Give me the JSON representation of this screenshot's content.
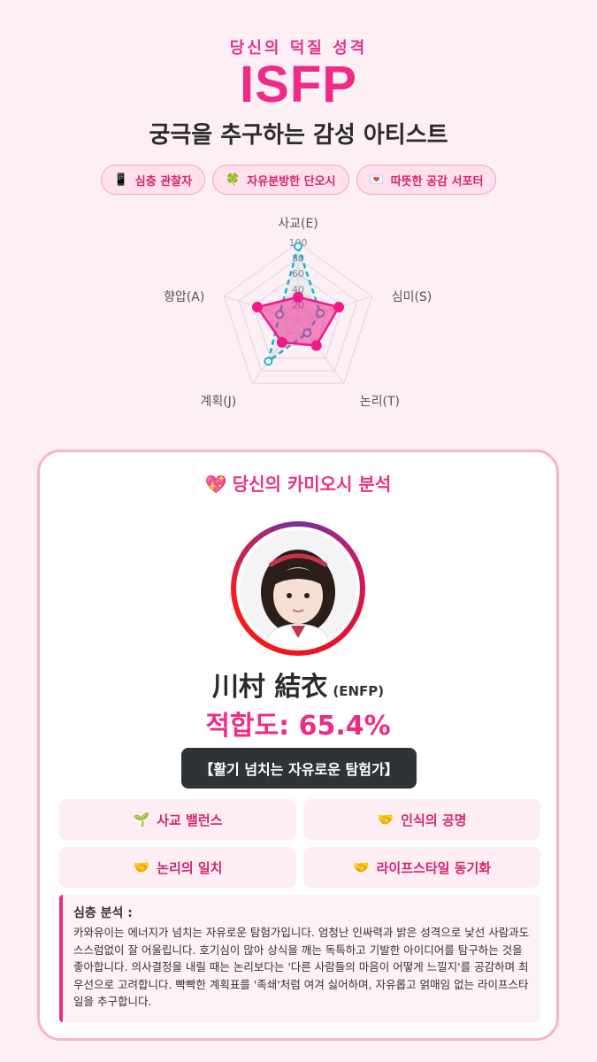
{
  "header": {
    "subtitle": "당신의 덕질 성격",
    "type": "ISFP",
    "type_description": "궁극을 추구하는 감성 아티스트"
  },
  "tags": [
    {
      "icon": "phone-icon",
      "glyph": "📱",
      "label": "심층 관찰자"
    },
    {
      "icon": "clover-icon",
      "glyph": "🍀",
      "label": "자유분방한 단오시"
    },
    {
      "icon": "love-letter-icon",
      "glyph": "💌",
      "label": "따뜻한 공감 서포터"
    }
  ],
  "radar": {
    "axes": [
      "사교(E)",
      "심미(S)",
      "논리(T)",
      "계획(J)",
      "향압(A)"
    ],
    "ticks": [
      "100",
      "80",
      "60",
      "40",
      "20"
    ],
    "user_values": [
      30,
      55,
      40,
      35,
      55
    ],
    "oshi_values": [
      95,
      30,
      20,
      65,
      25
    ],
    "user_color": "#f0198a",
    "oshi_color": "#1bb3c7"
  },
  "card": {
    "title": "당신의 카미오시 분석",
    "title_icon": "sparkling-heart-icon",
    "oshi_name": "川村 結衣",
    "oshi_mbti": "(ENFP)",
    "match_rate": "적합도: 65.4%",
    "oshi_title": "【활기 넘치는 자유로운 탐험가】",
    "compat_items": [
      {
        "icon": "seedling-icon",
        "glyph": "🌱",
        "label": "사교 밸런스"
      },
      {
        "icon": "handshake-icon",
        "glyph": "🤝",
        "label": "인식의 공명"
      },
      {
        "icon": "handshake-icon",
        "glyph": "🤝",
        "label": "논리의 일치"
      },
      {
        "icon": "handshake-icon",
        "glyph": "🤝",
        "label": "라이프스타일 동기화"
      }
    ],
    "analysis_head": "심층 분석 :",
    "analysis_body": "카와유이는 에너지가 넘치는 자유로운 탐험가입니다. 엄청난 인싸력과 밝은 성격으로 낯선 사람과도 스스럼없이 잘 어울립니다. 호기심이 많아 상식을 깨는 독특하고 기발한 아이디어를 탐구하는 것을 좋아합니다. 의사결정을 내릴 때는 논리보다는 '다른 사람들의 마음이 어떻게 느낄지'를 공감하며 최우선으로 고려합니다. 빡빡한 계획표를 '족쇄'처럼 여겨 싫어하며, 자유롭고 얽매임 없는 라이프스타일을 추구합니다."
  },
  "colors": {
    "accent": "#ef2b88",
    "background": "#fdf0f4",
    "card_border": "#f7b3cc",
    "dark_button": "#2e3436"
  }
}
